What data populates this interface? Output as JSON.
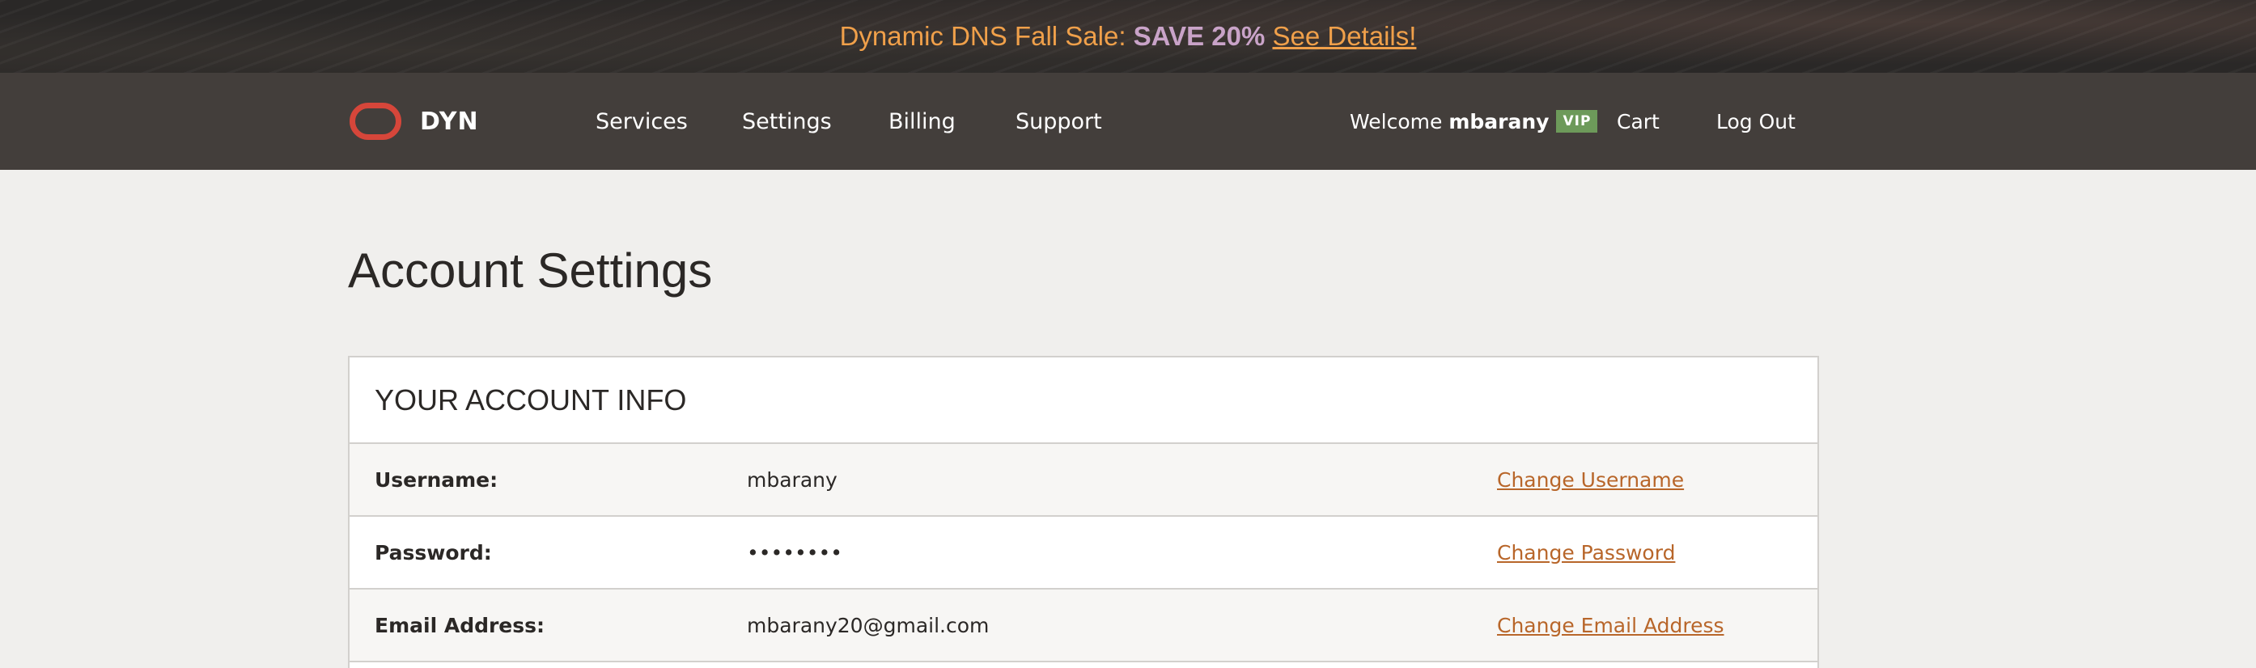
{
  "promo": {
    "text": "Dynamic DNS Fall Sale:",
    "highlight": "SAVE 20%",
    "link": "See Details!"
  },
  "nav": {
    "brand": "DYN",
    "items": [
      "Services",
      "Settings",
      "Billing",
      "Support"
    ],
    "welcome_prefix": "Welcome",
    "username": "mbarany",
    "badge": "VIP",
    "cart": "Cart",
    "logout": "Log Out"
  },
  "page": {
    "title": "Account Settings"
  },
  "account_info": {
    "header": "YOUR ACCOUNT INFO",
    "rows": [
      {
        "label": "Username:",
        "value": "mbarany",
        "action": "Change Username"
      },
      {
        "label": "Password:",
        "value": "••••••••",
        "action": "Change Password"
      },
      {
        "label": "Email Address:",
        "value": "mbarany20@gmail.com",
        "action": "Change Email Address"
      }
    ]
  },
  "colors": {
    "accent_orange": "#f0a04a",
    "link_brown": "#b8662a",
    "logo_red": "#d6463a",
    "vip_green": "#6d9a5a",
    "nav_bg": "#433e3b"
  }
}
